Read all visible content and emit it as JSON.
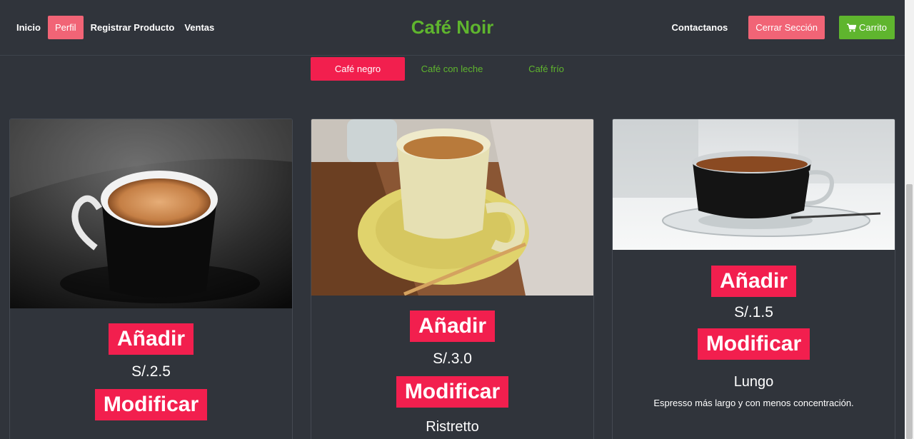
{
  "nav": {
    "links": [
      "Inicio",
      "Perfil",
      "Registrar Producto",
      "Ventas"
    ],
    "brand": "Café Noir",
    "contact": "Contactanos",
    "logout": "Cerrar Sección",
    "cart": "Carrito"
  },
  "tabs": [
    "Café negro",
    "Café con leche",
    "Café frío"
  ],
  "products": [
    {
      "add_label": "Añadir",
      "price": "S/.2.5",
      "edit_label": "Modificar",
      "name": "",
      "description": ""
    },
    {
      "add_label": "Añadir",
      "price": "S/.3.0",
      "edit_label": "Modificar",
      "name": "Ristretto",
      "description": ""
    },
    {
      "add_label": "Añadir",
      "price": "S/.1.5",
      "edit_label": "Modificar",
      "name": "Lungo",
      "description": "Espresso más largo y con menos concentración."
    }
  ],
  "colors": {
    "background": "#30343b",
    "brand_green": "#5fb52e",
    "accent_pink": "#f21f4e",
    "soft_pink": "#f16476"
  },
  "icons": {
    "cart": "cart-icon"
  }
}
